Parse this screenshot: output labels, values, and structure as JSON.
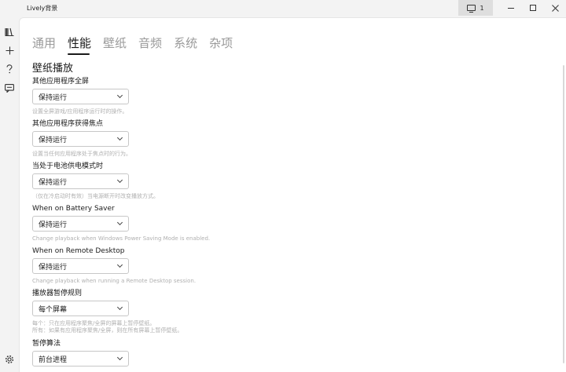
{
  "window": {
    "title": "Lively背景",
    "monitor_label": "1"
  },
  "tabs": [
    {
      "label": "通用"
    },
    {
      "label": "性能"
    },
    {
      "label": "壁纸"
    },
    {
      "label": "音频"
    },
    {
      "label": "系统"
    },
    {
      "label": "杂项"
    }
  ],
  "active_tab": "性能",
  "section_title": "壁纸播放",
  "settings": [
    {
      "label": "其他应用程序全屏",
      "value": "保持运行",
      "description": "设置全屏游戏/应用程序运行时的操作。"
    },
    {
      "label": "其他应用程序获得焦点",
      "value": "保持运行",
      "description": "设置当任何应用程序处于焦点时的行为。"
    },
    {
      "label": "当处于电池供电模式时",
      "value": "保持运行",
      "description": "（仅在冷启动时有效）当电源断开时改变播放方式。"
    },
    {
      "label": "When on Battery Saver",
      "value": "保持运行",
      "description": "Change playback when Windows Power Saving Mode is enabled."
    },
    {
      "label": "When on Remote Desktop",
      "value": "保持运行",
      "description": "Change playback when running a Remote Desktop session."
    },
    {
      "label": "播放器暂停规则",
      "value": "每个屏幕",
      "description": "每个：只在应用程序聚焦/全屏的屏幕上暂停壁纸。\n所有：如果有应用程序聚焦/全屏，则在所有屏幕上暂停壁纸。"
    },
    {
      "label": "暂停算法",
      "value": "前台进程",
      "description": ""
    }
  ],
  "icons": {
    "library": "library-icon",
    "add": "plus-icon",
    "help": "question-icon",
    "feedback": "chat-icon",
    "settings": "gear-icon"
  }
}
